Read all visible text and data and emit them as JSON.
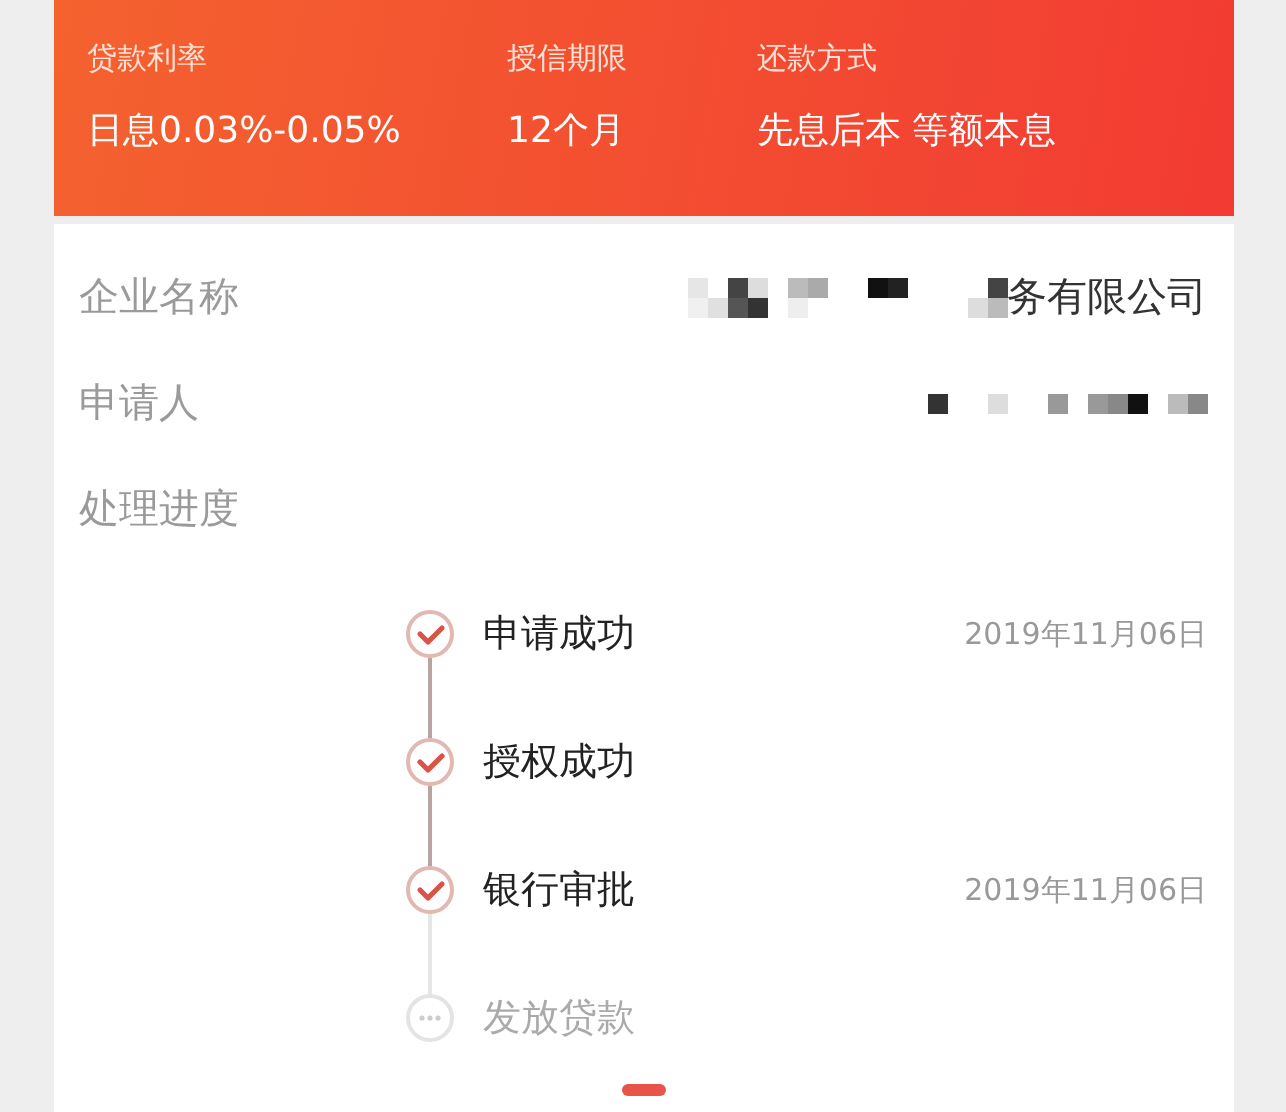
{
  "loan_summary": [
    {
      "label": "贷款利率",
      "value": "日息0.03%-0.05%"
    },
    {
      "label": "授信期限",
      "value": "12个月"
    },
    {
      "label": "还款方式",
      "value": "先息后本 等额本息"
    }
  ],
  "details": [
    {
      "label": "企业名称",
      "value": "务有限公司",
      "redacted": true
    },
    {
      "label": "申请人",
      "redacted": true
    }
  ],
  "progress": {
    "label": "处理进度",
    "steps": [
      {
        "title": "申请成功",
        "date": "2019年11月06日",
        "done": true
      },
      {
        "title": "授权成功",
        "done": true
      },
      {
        "title": "银行审批",
        "date": "2019年11月06日",
        "done": true
      },
      {
        "title": "发放贷款",
        "done": false
      }
    ]
  },
  "pager": {
    "shown": true
  }
}
